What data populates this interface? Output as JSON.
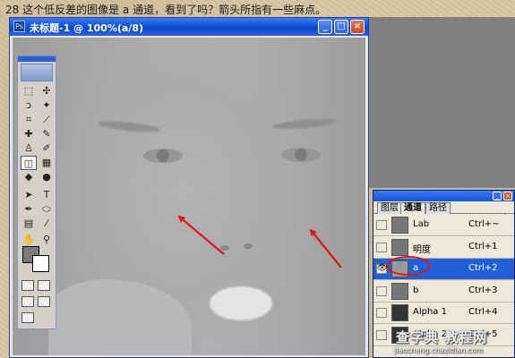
{
  "caption": "28 这个低反差的图像是 a 通道，看到了吗？箭头所指有一些麻点。",
  "document": {
    "title": "未标题-1 @ 100%(a/8)",
    "buttons": {
      "minimize": "_",
      "maximize": "□",
      "close": "×"
    }
  },
  "toolbox": {
    "tools": [
      {
        "name": "marquee-tool-icon",
        "glyph": "⬚"
      },
      {
        "name": "move-tool-icon",
        "glyph": "✣"
      },
      {
        "name": "lasso-tool-icon",
        "glyph": "ↄ"
      },
      {
        "name": "magic-wand-tool-icon",
        "glyph": "✦"
      },
      {
        "name": "crop-tool-icon",
        "glyph": "⌗"
      },
      {
        "name": "slice-tool-icon",
        "glyph": "⟋"
      },
      {
        "name": "healing-brush-tool-icon",
        "glyph": "✚"
      },
      {
        "name": "brush-tool-icon",
        "glyph": "✎"
      },
      {
        "name": "stamp-tool-icon",
        "glyph": "♙"
      },
      {
        "name": "history-brush-tool-icon",
        "glyph": "✐"
      },
      {
        "name": "eraser-tool-icon",
        "glyph": "◫"
      },
      {
        "name": "gradient-tool-icon",
        "glyph": "▦"
      },
      {
        "name": "blur-tool-icon",
        "glyph": "◆"
      },
      {
        "name": "dodge-tool-icon",
        "glyph": "●"
      },
      {
        "name": "path-select-tool-icon",
        "glyph": "➤"
      },
      {
        "name": "type-tool-icon",
        "glyph": "T"
      },
      {
        "name": "pen-tool-icon",
        "glyph": "✒"
      },
      {
        "name": "shape-tool-icon",
        "glyph": "⬭"
      },
      {
        "name": "notes-tool-icon",
        "glyph": "▤"
      },
      {
        "name": "eyedropper-tool-icon",
        "glyph": "⁄"
      },
      {
        "name": "hand-tool-icon",
        "glyph": "✋"
      },
      {
        "name": "zoom-tool-icon",
        "glyph": "⚲"
      }
    ]
  },
  "channels_panel": {
    "tabs": [
      "图层",
      "通道",
      "路径"
    ],
    "active_tab": "通道",
    "menu_arrow": "▶",
    "rows": [
      {
        "name": "Lab",
        "shortcut": "Ctrl+~",
        "selected": false,
        "visible": false
      },
      {
        "name": "明度",
        "shortcut": "Ctrl+1",
        "selected": false,
        "visible": false
      },
      {
        "name": "a",
        "shortcut": "Ctrl+2",
        "selected": true,
        "visible": true
      },
      {
        "name": "b",
        "shortcut": "Ctrl+3",
        "selected": false,
        "visible": false
      },
      {
        "name": "Alpha 1",
        "shortcut": "Ctrl+4",
        "selected": false,
        "visible": false
      },
      {
        "name": "Alpha 2",
        "shortcut": "Ctrl+5",
        "selected": false,
        "visible": false
      }
    ]
  },
  "watermark": {
    "main": "查字典 教程网",
    "url": "jiaocheng.chazidian.com"
  },
  "colors": {
    "arrow": "#e01818",
    "selection": "#1f5fd8",
    "titlebar": "#1654d8"
  }
}
